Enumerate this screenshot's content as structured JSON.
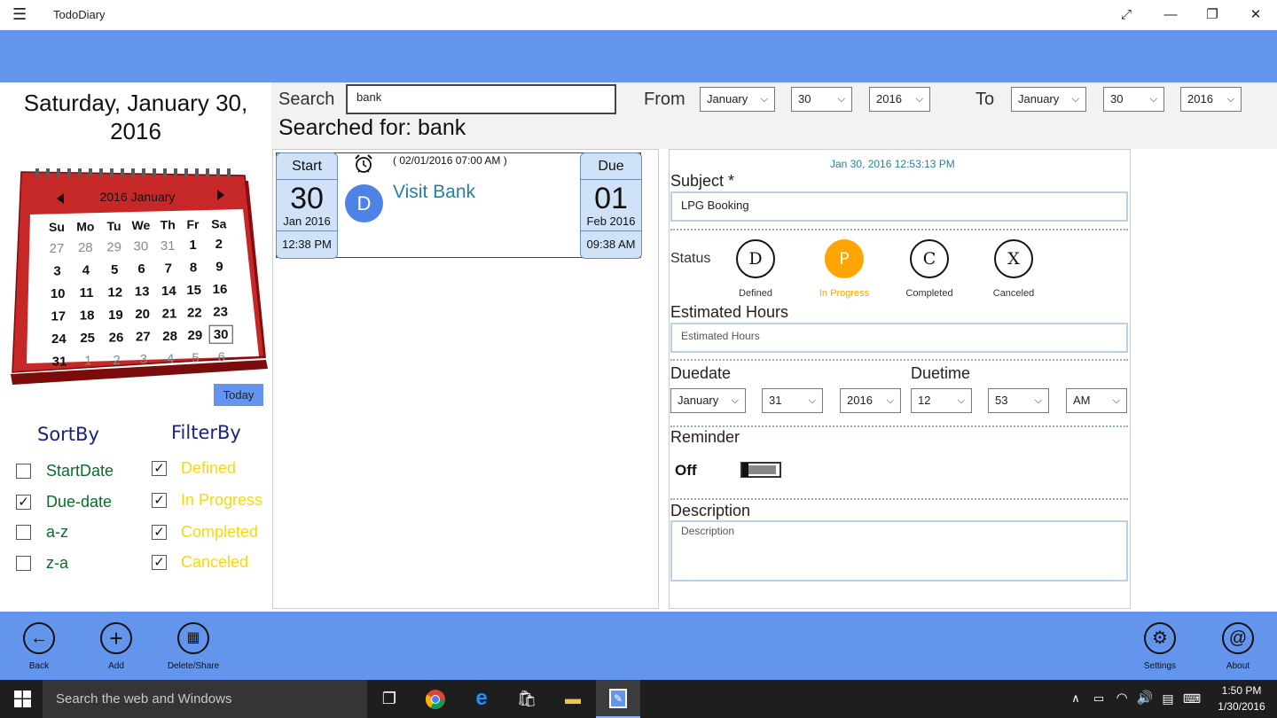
{
  "app": {
    "title": "TodoDiary",
    "menu_icon": "hamburger-icon"
  },
  "window_buttons": {
    "fullscreen": "⤢",
    "minimize": "—",
    "restore": "❐",
    "close": "✕"
  },
  "left": {
    "date_line1": "Saturday, January 30,",
    "date_line2": "2016",
    "calendar": {
      "header": "2016 January",
      "weekdays": [
        "Su",
        "Mo",
        "Tu",
        "We",
        "Th",
        "Fr",
        "Sa"
      ],
      "weeks": [
        [
          "27",
          "28",
          "29",
          "30",
          "31",
          "1",
          "2"
        ],
        [
          "3",
          "4",
          "5",
          "6",
          "7",
          "8",
          "9"
        ],
        [
          "10",
          "11",
          "12",
          "13",
          "14",
          "15",
          "16"
        ],
        [
          "17",
          "18",
          "19",
          "20",
          "21",
          "22",
          "23"
        ],
        [
          "24",
          "25",
          "26",
          "27",
          "28",
          "29",
          "30"
        ],
        [
          "31",
          "1",
          "2",
          "3",
          "4",
          "5",
          "6"
        ]
      ],
      "selected": "30"
    },
    "today_label": "Today",
    "sortby_title": "SortBy",
    "filterby_title": "FilterBy",
    "sortby": [
      {
        "label": "StartDate",
        "checked": false
      },
      {
        "label": "Due-date",
        "checked": true
      },
      {
        "label": "a-z",
        "checked": false
      },
      {
        "label": "z-a",
        "checked": false
      }
    ],
    "filterby": [
      {
        "label": "Defined",
        "checked": true
      },
      {
        "label": "In Progress",
        "checked": true
      },
      {
        "label": "Completed",
        "checked": true
      },
      {
        "label": "Canceled",
        "checked": true
      }
    ]
  },
  "search": {
    "label": "Search",
    "value": "bank",
    "searched_for": "Searched for: bank",
    "from_label": "From",
    "to_label": "To",
    "from": {
      "month": "January",
      "day": "30",
      "year": "2016"
    },
    "to": {
      "month": "January",
      "day": "30",
      "year": "2016"
    }
  },
  "task": {
    "start": {
      "header": "Start",
      "day": "30",
      "monthyear": "Jan 2016",
      "time": "12:38 PM"
    },
    "due": {
      "header": "Due",
      "day": "01",
      "monthyear": "Feb 2016",
      "time": "09:38 AM"
    },
    "reminder_time": "( 02/01/2016 07:00 AM )",
    "status_letter": "D",
    "subject": "Visit Bank"
  },
  "detail": {
    "timestamp": "Jan 30, 2016   12:53:13 PM",
    "subject_label": "Subject *",
    "subject_value": "LPG Booking",
    "status_label": "Status",
    "statuses": [
      {
        "letter": "D",
        "label": "Defined"
      },
      {
        "letter": "P",
        "label": "In Progress"
      },
      {
        "letter": "C",
        "label": "Completed"
      },
      {
        "letter": "X",
        "label": "Canceled"
      }
    ],
    "active_status_color": "#ffa500",
    "hours_label": "Estimated Hours",
    "hours_placeholder": "Estimated Hours",
    "duedate_label": "Duedate",
    "duetime_label": "Duetime",
    "due": {
      "month": "January",
      "day": "31",
      "year": "2016",
      "hour": "12",
      "minute": "53",
      "ampm": "AM"
    },
    "reminder_label": "Reminder",
    "reminder_state": "Off",
    "description_label": "Description",
    "description_placeholder": "Description"
  },
  "appbar": {
    "back": "Back",
    "add": "Add",
    "delete_share": "Delete/Share",
    "settings": "Settings",
    "about": "About"
  },
  "taskbar": {
    "search_placeholder": "Search the web and Windows",
    "time": "1:50 PM",
    "date": "1/30/2016"
  },
  "colors": {
    "accent": "#6495ed",
    "filter_text": "#f5d90a",
    "sort_text": "#0a6b2a",
    "calendar_red": "#b71c1c"
  }
}
